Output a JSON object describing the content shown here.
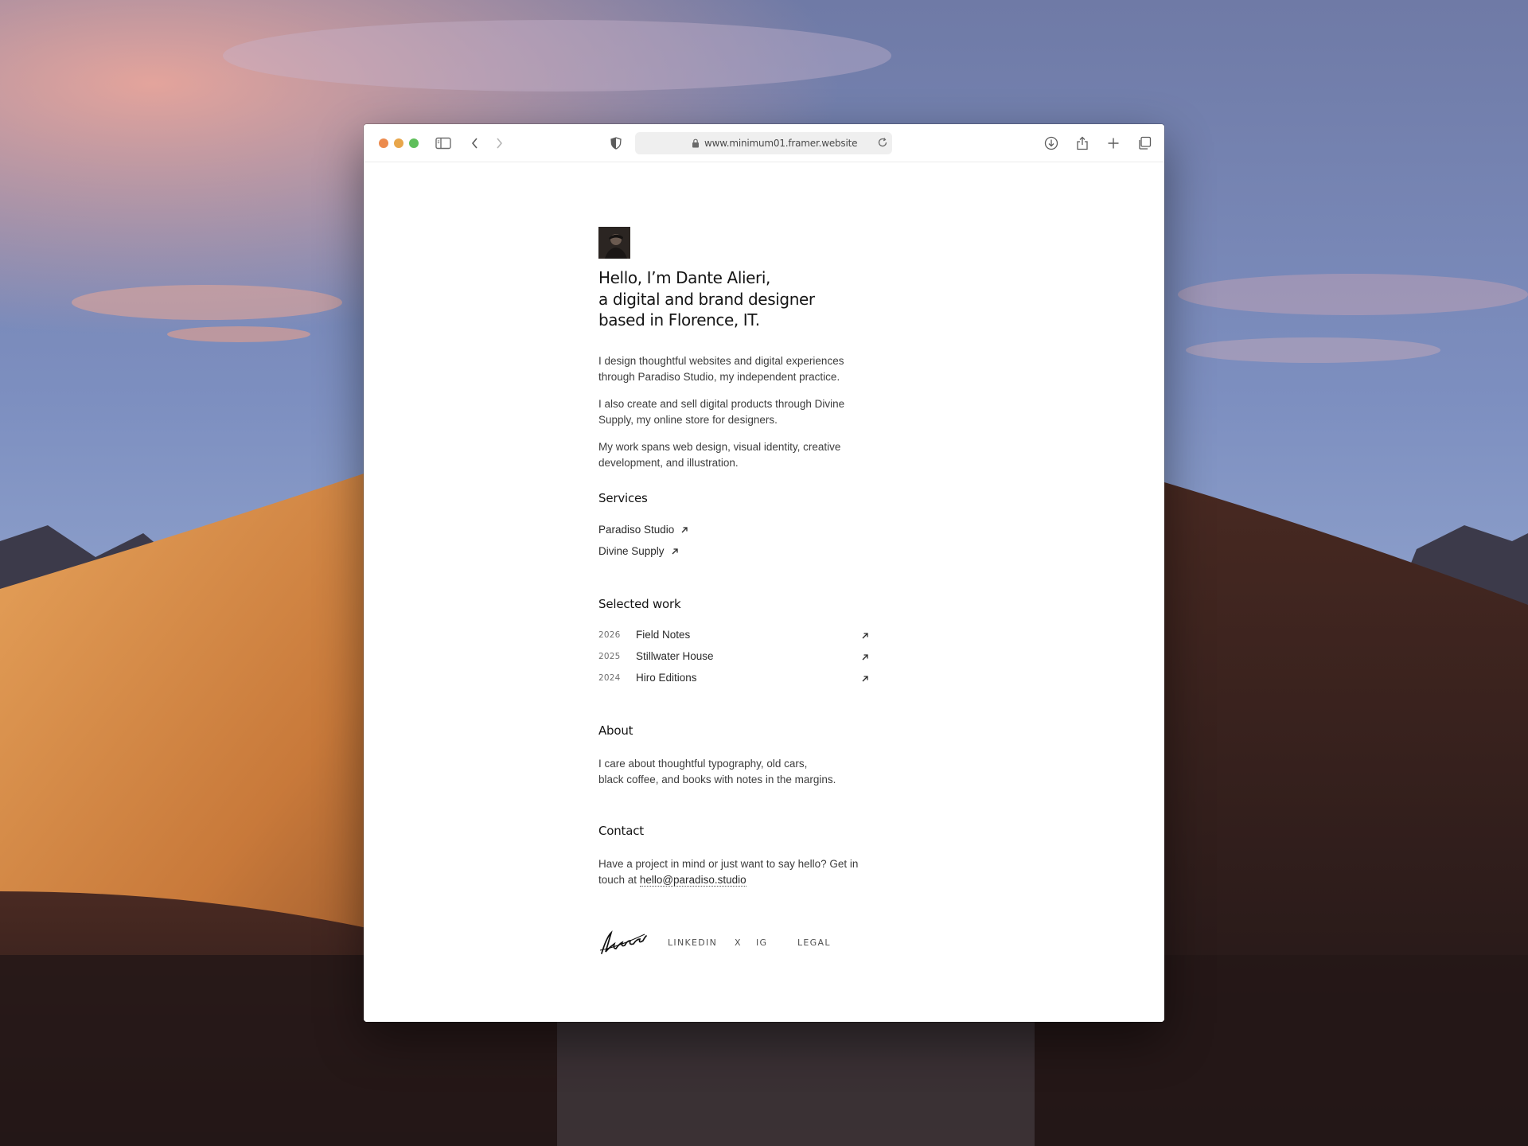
{
  "browser": {
    "url": "www.minimum01.framer.website"
  },
  "hero": {
    "headline_lines": [
      "Hello, I’m Dante Alieri,",
      "a digital and brand designer",
      "based in Florence, IT."
    ],
    "paragraphs": [
      "I design thoughtful websites and digital experiences through Paradiso Studio, my independent practice.",
      "I also create and sell digital products through Divine Supply, my online store for designers.",
      "My work spans web design, visual identity, creative development, and illustration."
    ]
  },
  "services": {
    "title": "Services",
    "items": [
      "Paradiso Studio",
      "Divine Supply"
    ]
  },
  "work": {
    "title": "Selected work",
    "items": [
      {
        "year": "2026",
        "title": "Field Notes"
      },
      {
        "year": "2025",
        "title": "Stillwater House"
      },
      {
        "year": "2024",
        "title": "Hiro Editions"
      }
    ]
  },
  "about": {
    "title": "About",
    "lines": [
      "I care about thoughtful typography, old cars,",
      "black coffee, and books with notes in the margins."
    ]
  },
  "contact": {
    "title": "Contact",
    "text": "Have a project in mind or just want to say hello? Get in touch at",
    "email": "hello@paradiso.studio"
  },
  "footer": {
    "links": [
      "LINKEDIN",
      "X",
      "IG",
      "LEGAL"
    ]
  },
  "colors": {
    "traffic_red": "#ec8b4e",
    "traffic_yellow": "#e8a64b",
    "traffic_green": "#5fbf5b",
    "text": "#1b1b1b"
  }
}
